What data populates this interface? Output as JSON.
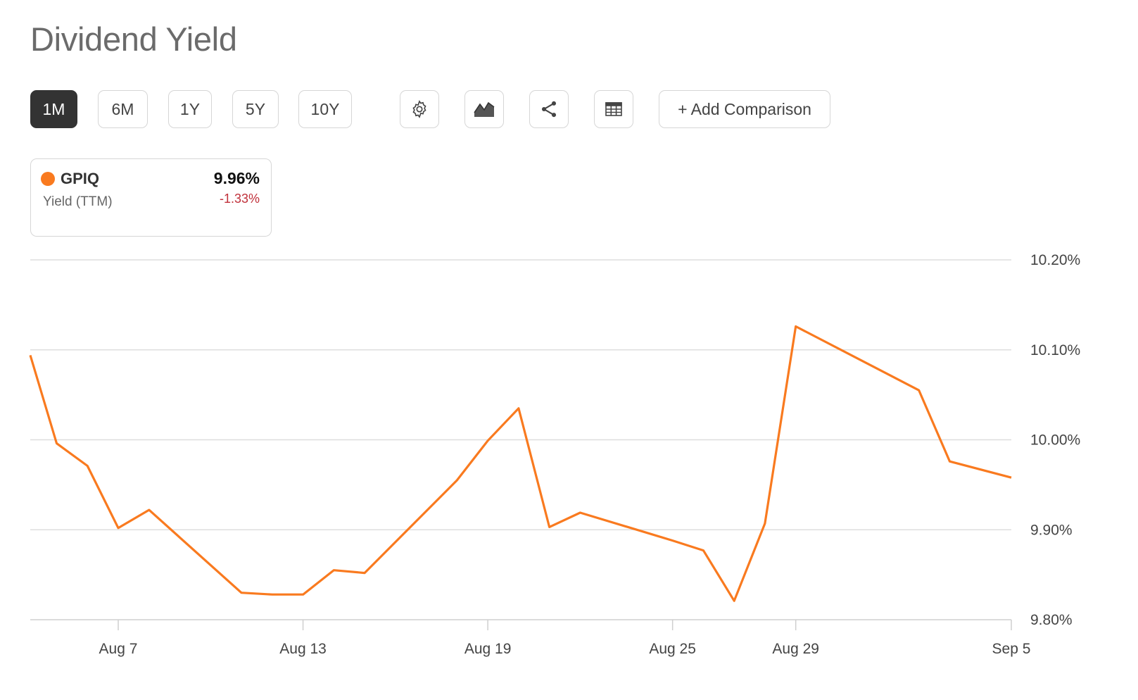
{
  "title": "Dividend Yield",
  "toolbar": {
    "ranges": [
      "1M",
      "6M",
      "1Y",
      "5Y",
      "10Y"
    ],
    "active_range": "1M",
    "icons": [
      "gear-icon",
      "chart-type-icon",
      "share-icon",
      "table-icon"
    ],
    "add_comparison_label": "+ Add Comparison"
  },
  "legend": {
    "ticker": "GPIQ",
    "subtitle": "Yield (TTM)",
    "value": "9.96%",
    "change": "-1.33%",
    "color": "#f97a1f",
    "change_color": "#c0303a"
  },
  "chart_data": {
    "type": "line",
    "title": "",
    "xlabel": "",
    "ylabel": "",
    "ylim": [
      9.8,
      10.2
    ],
    "yticks": [
      "10.20%",
      "10.10%",
      "10.00%",
      "9.90%",
      "9.80%"
    ],
    "xtick_labels": [
      "Aug 7",
      "Aug 13",
      "Aug 19",
      "Aug 25",
      "Aug 29",
      "Sep 5"
    ],
    "grid": true,
    "series": [
      {
        "name": "GPIQ",
        "color": "#f97a1f",
        "points": [
          [
            "2025-08-04",
            10.094
          ],
          [
            "2025-08-05",
            9.996
          ],
          [
            "2025-08-06",
            9.971
          ],
          [
            "2025-08-07",
            9.902
          ],
          [
            "2025-08-08",
            9.922
          ],
          [
            "2025-08-11",
            9.83
          ],
          [
            "2025-08-12",
            9.828
          ],
          [
            "2025-08-13",
            9.828
          ],
          [
            "2025-08-14",
            9.855
          ],
          [
            "2025-08-15",
            9.852
          ],
          [
            "2025-08-18",
            9.955
          ],
          [
            "2025-08-19",
            9.999
          ],
          [
            "2025-08-20",
            10.035
          ],
          [
            "2025-08-21",
            9.903
          ],
          [
            "2025-08-22",
            9.919
          ],
          [
            "2025-08-25",
            9.888
          ],
          [
            "2025-08-26",
            9.877
          ],
          [
            "2025-08-27",
            9.821
          ],
          [
            "2025-08-28",
            9.907
          ],
          [
            "2025-08-29",
            10.126
          ],
          [
            "2025-09-02",
            10.055
          ],
          [
            "2025-09-03",
            9.976
          ],
          [
            "2025-09-04",
            9.958
          ]
        ]
      }
    ]
  }
}
